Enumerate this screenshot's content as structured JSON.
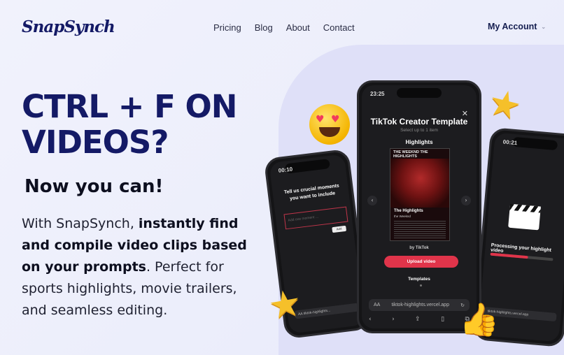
{
  "nav": {
    "logo": "SnapSynch",
    "links": [
      "Pricing",
      "Blog",
      "About",
      "Contact"
    ],
    "account": "My Account"
  },
  "hero": {
    "title_line1": "CTRL + F ON",
    "title_line2": "VIDEOS?",
    "subtitle": "Now you can!",
    "desc_pre": "With SnapSynch, ",
    "desc_bold": "instantly find and compile video clips based on your prompts",
    "desc_post": ". Perfect for sports highlights, movie trailers, and seamless editing."
  },
  "phone_center": {
    "time": "23:25",
    "status_right": "5G",
    "title": "TikTok Creator Template",
    "select_hint": "Select up to 1 item",
    "section": "Highlights",
    "cover_header": "THE WEEKND   THE HIGHLIGHTS",
    "cover_title": "The Highlights",
    "cover_subtitle": "the Weeknd",
    "by": "by TikTok",
    "upload": "Upload video",
    "templates": "Templates",
    "url_aa": "AA",
    "url": "tiktok-highlights.vercel.app"
  },
  "phone_left": {
    "time": "00:10",
    "prompt": "Tell us crucial moments you want to include",
    "input_placeholder": "Add one moment ...",
    "button": "Add",
    "url": "AA  tiktok-highlights..."
  },
  "phone_right": {
    "time": "00:21",
    "processing": "Processing your highlight video",
    "progress": 0.6,
    "url": "tiktok-highlights.vercel.app"
  },
  "icons": {
    "star": "★",
    "heart": "♥",
    "thumb": "👍",
    "back": "‹",
    "forward": "›",
    "share": "⇪",
    "book": "▯",
    "tabs": "⧉",
    "refresh": "↻",
    "lock": "🔒",
    "close": "✕"
  },
  "colors": {
    "brand": "#141a66",
    "accent": "#e0344a",
    "star": "#f5c02a"
  }
}
